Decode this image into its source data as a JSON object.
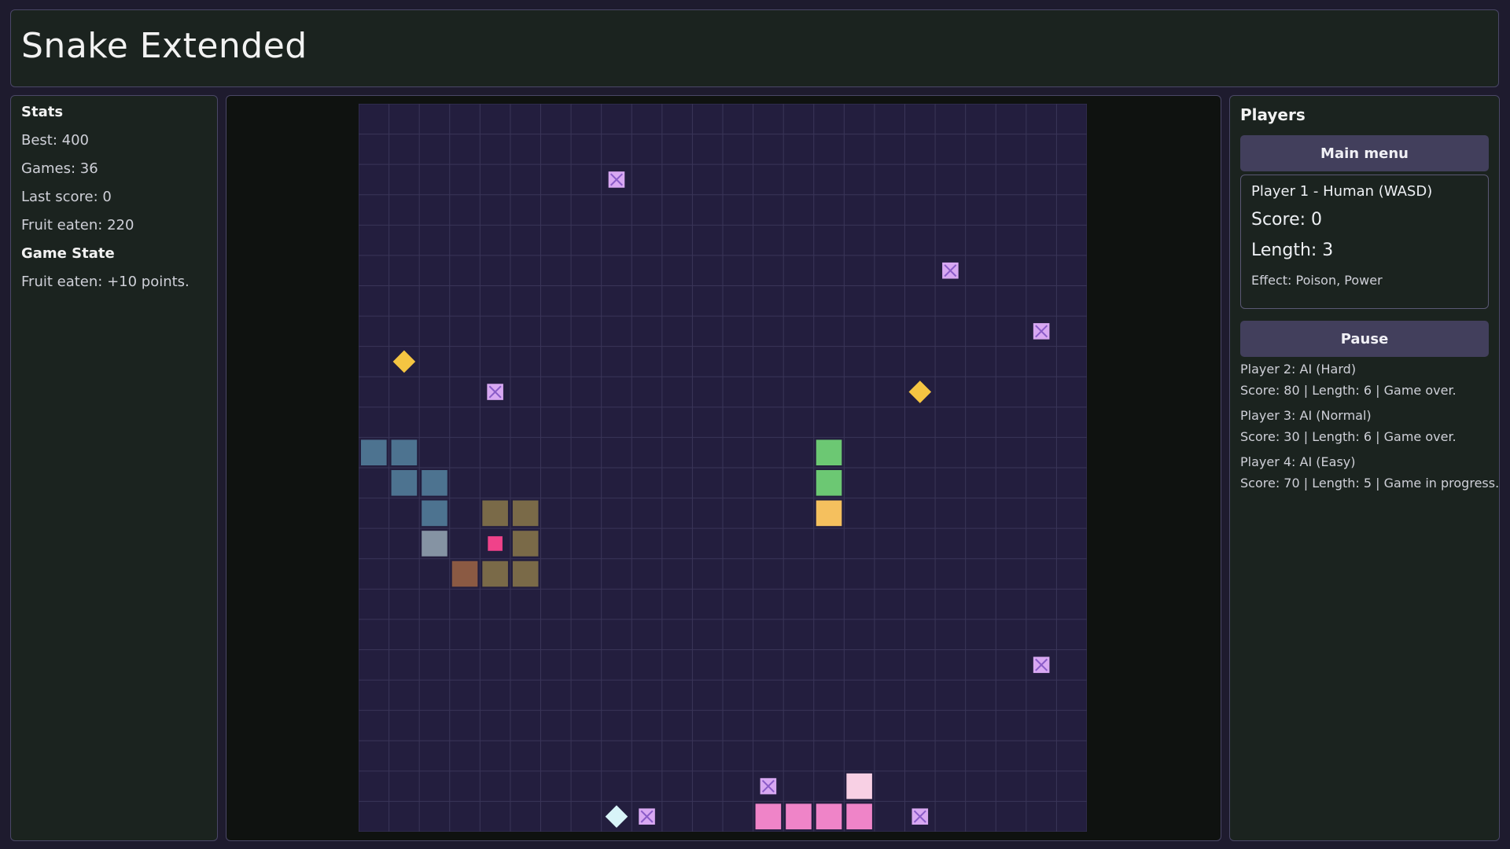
{
  "app": {
    "title": "Snake Extended"
  },
  "stats": {
    "heading": "Stats",
    "best": "Best: 400",
    "games": "Games: 36",
    "last_score": "Last score: 0",
    "fruit_eaten": "Fruit eaten: 220",
    "state_heading": "Game State",
    "state_message": "Fruit eaten: +10 points."
  },
  "players_panel": {
    "heading": "Players",
    "main_menu_label": "Main menu",
    "pause_label": "Pause",
    "player1": {
      "name": "Player 1 - Human (WASD)",
      "score": "Score: 0",
      "length": "Length: 3",
      "effect": "Effect: Poison, Power"
    },
    "others": [
      {
        "name": "Player 2: AI (Hard)",
        "info": "Score: 80 | Length: 6 | Game over."
      },
      {
        "name": "Player 3: AI (Normal)",
        "info": "Score: 30 | Length: 6 | Game over."
      },
      {
        "name": "Player 4: AI (Easy)",
        "info": "Score: 70 | Length: 5 | Game in progress."
      }
    ]
  },
  "board": {
    "cols": 24,
    "rows": 24,
    "colors": {
      "background": "#231e3e",
      "grid_line": "#3a3558",
      "poison": "#d8a8f2",
      "poison_x": "#8a5cc8",
      "power": "#f5c542",
      "special": "#d8f4f8",
      "fruit": "#f0428a"
    },
    "poison_cells": [
      [
        8,
        2
      ],
      [
        19,
        5
      ],
      [
        22,
        7
      ],
      [
        4,
        9
      ],
      [
        22,
        18
      ],
      [
        13,
        22
      ],
      [
        9,
        23
      ],
      [
        18,
        23
      ]
    ],
    "power_cells": [
      [
        1,
        8
      ],
      [
        18,
        9
      ]
    ],
    "special_cells": [
      [
        8,
        23
      ]
    ],
    "fruit_cells": [
      [
        4,
        14
      ]
    ],
    "snakes": [
      {
        "name": "blue",
        "color": "#4d7390",
        "head_color": "#8593a3",
        "head": [
          2,
          14
        ],
        "body": [
          [
            2,
            13
          ],
          [
            2,
            12
          ],
          [
            1,
            12
          ],
          [
            1,
            11
          ],
          [
            0,
            11
          ]
        ]
      },
      {
        "name": "brown",
        "color": "#7a6a48",
        "head_color": "#8b5a43",
        "head": [
          3,
          15
        ],
        "body": [
          [
            4,
            15
          ],
          [
            5,
            15
          ],
          [
            5,
            14
          ],
          [
            5,
            13
          ],
          [
            4,
            13
          ]
        ]
      },
      {
        "name": "green",
        "color": "#6cc873",
        "head_color": "#f5c05e",
        "head": [
          15,
          13
        ],
        "body": [
          [
            15,
            12
          ],
          [
            15,
            11
          ]
        ]
      },
      {
        "name": "pink",
        "color": "#ef84c8",
        "head_color": "#f8d0e4",
        "head": [
          16,
          22
        ],
        "body": [
          [
            16,
            23
          ],
          [
            15,
            23
          ],
          [
            14,
            23
          ],
          [
            13,
            23
          ]
        ]
      }
    ]
  }
}
